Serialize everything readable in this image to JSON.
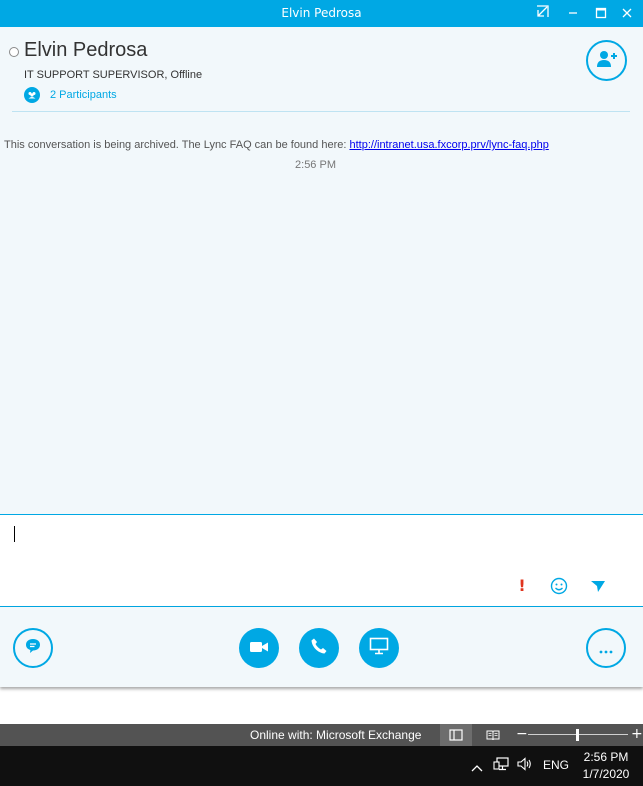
{
  "window": {
    "title": "Elvin Pedrosa",
    "controls": [
      "popout-icon",
      "minimize-icon",
      "maximize-icon",
      "close-icon"
    ]
  },
  "contact": {
    "name": "Elvin Pedrosa",
    "info": "IT SUPPORT SUPERVISOR,  Offline",
    "presence": "offline",
    "participants_label": "2 Participants"
  },
  "conversation": {
    "archive_text": "This conversation is being archived. The Lync FAQ can be found here: ",
    "archive_link": "http://intranet.usa.fxcorp.prv/lync-faq.php",
    "time": "2:56 PM"
  },
  "compose": {
    "value": "",
    "importance_glyph": "!"
  },
  "actions": {
    "left": "im-icon",
    "middle": [
      "video-icon",
      "phone-icon",
      "present-screen-icon"
    ],
    "right": "more-options-icon"
  },
  "statusbar": {
    "online_text": "Online with: Microsoft Exchange",
    "zoom_level": 0.5
  },
  "taskbar": {
    "language": "ENG",
    "time": "2:56 PM",
    "date": "1/7/2020",
    "tray_icons": [
      "show-hidden-icons-icon",
      "network-icon",
      "volume-icon"
    ]
  },
  "colors": {
    "accent": "#00a8e4",
    "conversation_bg": "#f2f8fb",
    "importance": "#e0341e",
    "statusbar": "#535353",
    "taskbar": "#101010"
  }
}
